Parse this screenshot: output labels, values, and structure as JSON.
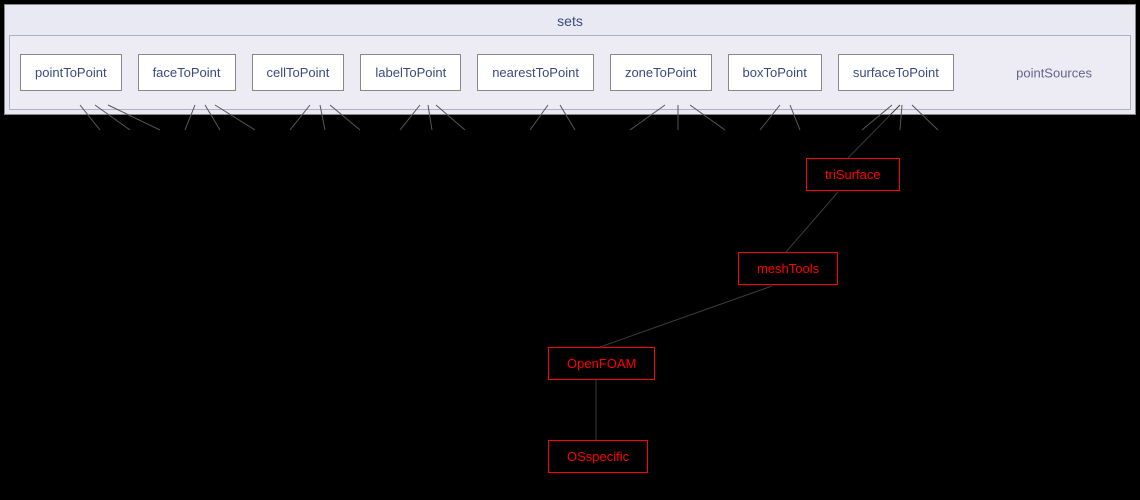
{
  "header": {
    "title": "sets"
  },
  "folder": {
    "label": "pointSources",
    "nodes": [
      {
        "label": "pointToPoint"
      },
      {
        "label": "faceToPoint"
      },
      {
        "label": "cellToPoint"
      },
      {
        "label": "labelToPoint"
      },
      {
        "label": "nearestToPoint"
      },
      {
        "label": "zoneToPoint"
      },
      {
        "label": "boxToPoint"
      },
      {
        "label": "surfaceToPoint"
      }
    ]
  },
  "red_nodes": [
    {
      "label": "triSurface"
    },
    {
      "label": "meshTools"
    },
    {
      "label": "OpenFOAM"
    },
    {
      "label": "OSspecific"
    }
  ]
}
